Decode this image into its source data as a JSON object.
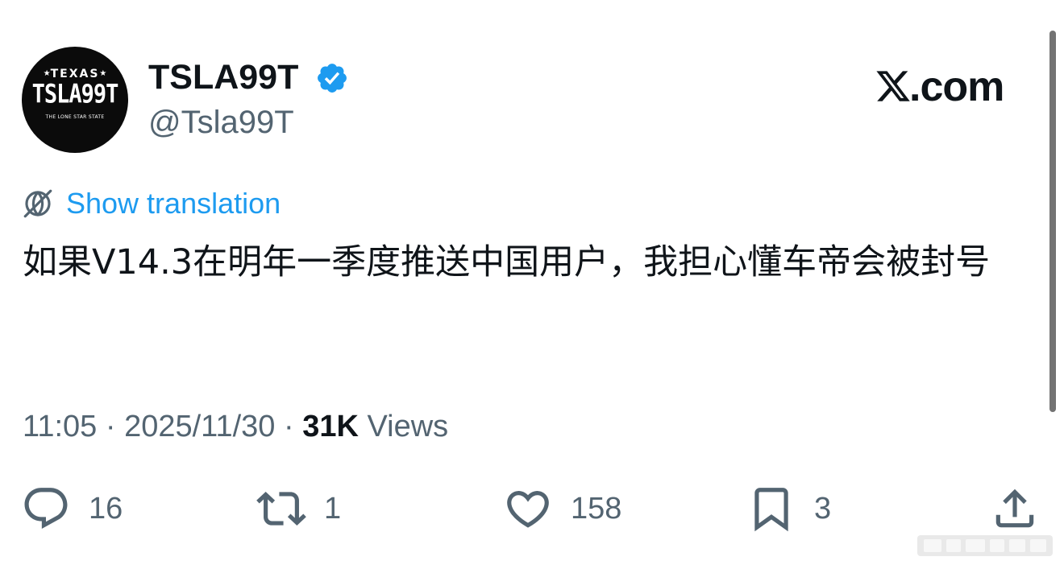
{
  "author": {
    "avatar_plate": {
      "state": "TEXAS",
      "plate_number": "TSLA99T",
      "slogan": "THE LONE STAR STATE"
    },
    "display_name": "TSLA99T",
    "handle": "@Tsla99T",
    "verified": true,
    "verified_icon": "verified-badge-icon",
    "verified_color": "#1d9bf0"
  },
  "brand": {
    "logo_icon": "x-logo-icon",
    "text": ".com"
  },
  "translation": {
    "icon": "globe-translate-icon",
    "label": "Show translation",
    "color": "#1d9bf0"
  },
  "tweet": {
    "text": "如果V14.3在明年一季度推送中国用户，我担心懂车帝会被封号"
  },
  "meta": {
    "time": "11:05",
    "separator": " · ",
    "date": "2025/11/30",
    "views_count": "31K",
    "views_label": "Views"
  },
  "actions": {
    "reply": {
      "icon": "reply-icon",
      "count": "16"
    },
    "retweet": {
      "icon": "retweet-icon",
      "count": "1"
    },
    "like": {
      "icon": "heart-icon",
      "count": "158"
    },
    "bookmark": {
      "icon": "bookmark-icon",
      "count": "3"
    },
    "share": {
      "icon": "share-icon"
    }
  },
  "colors": {
    "text_primary": "#0f1419",
    "text_secondary": "#536471",
    "accent": "#1d9bf0"
  }
}
